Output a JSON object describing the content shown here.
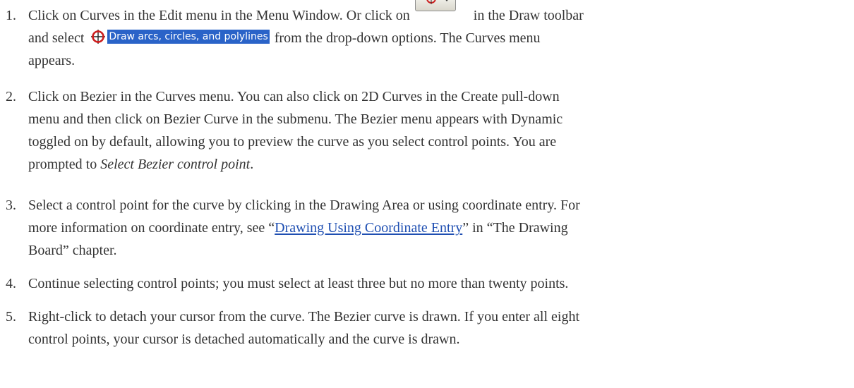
{
  "steps": [
    {
      "number": "1.",
      "line1_pre": "Click on Curves in the Edit menu in the Menu Window. Or click on",
      "line1_post": "in the Draw toolbar",
      "line2_pre": "and select",
      "option_label": "Draw arcs, circles, and polylines",
      "line2_post": "from the drop-down options. The Curves menu",
      "line3": "appears.",
      "toolbar_icon": "curve-target-icon",
      "option_icon": "curve-target-icon"
    },
    {
      "number": "2.",
      "line1": "Click on Bezier in the Curves menu. You can also click on 2D Curves in the Create pull-down",
      "line2": "menu and then click on Bezier Curve in the submenu. The Bezier menu appears with Dynamic",
      "line3": "toggled on by default, allowing you to preview the curve as you select control points. You are",
      "line4_pre": "prompted to ",
      "line4_em": "Select Bezier control point",
      "line4_post": "."
    },
    {
      "number": "3.",
      "line1": "Select a control point for the curve by clicking in the Drawing Area or using coordinate entry. For",
      "line2_pre": "more information on coordinate entry, see “",
      "line2_link": "Drawing Using Coordinate Entry",
      "line2_post": "” in “The Drawing",
      "line3": "Board” chapter."
    },
    {
      "number": "4.",
      "line1": "Continue selecting control points; you must select at least three but no more than twenty points."
    },
    {
      "number": "5.",
      "line1": "Right-click to detach your cursor from the curve. The Bezier curve is drawn. If you enter all eight",
      "line2": "control points, your cursor is detached automatically and the curve is drawn."
    }
  ],
  "colors": {
    "text": "#333333",
    "link": "#1f4fb2",
    "highlight": "#2a63c8",
    "icon_red": "#cc1f1f"
  }
}
